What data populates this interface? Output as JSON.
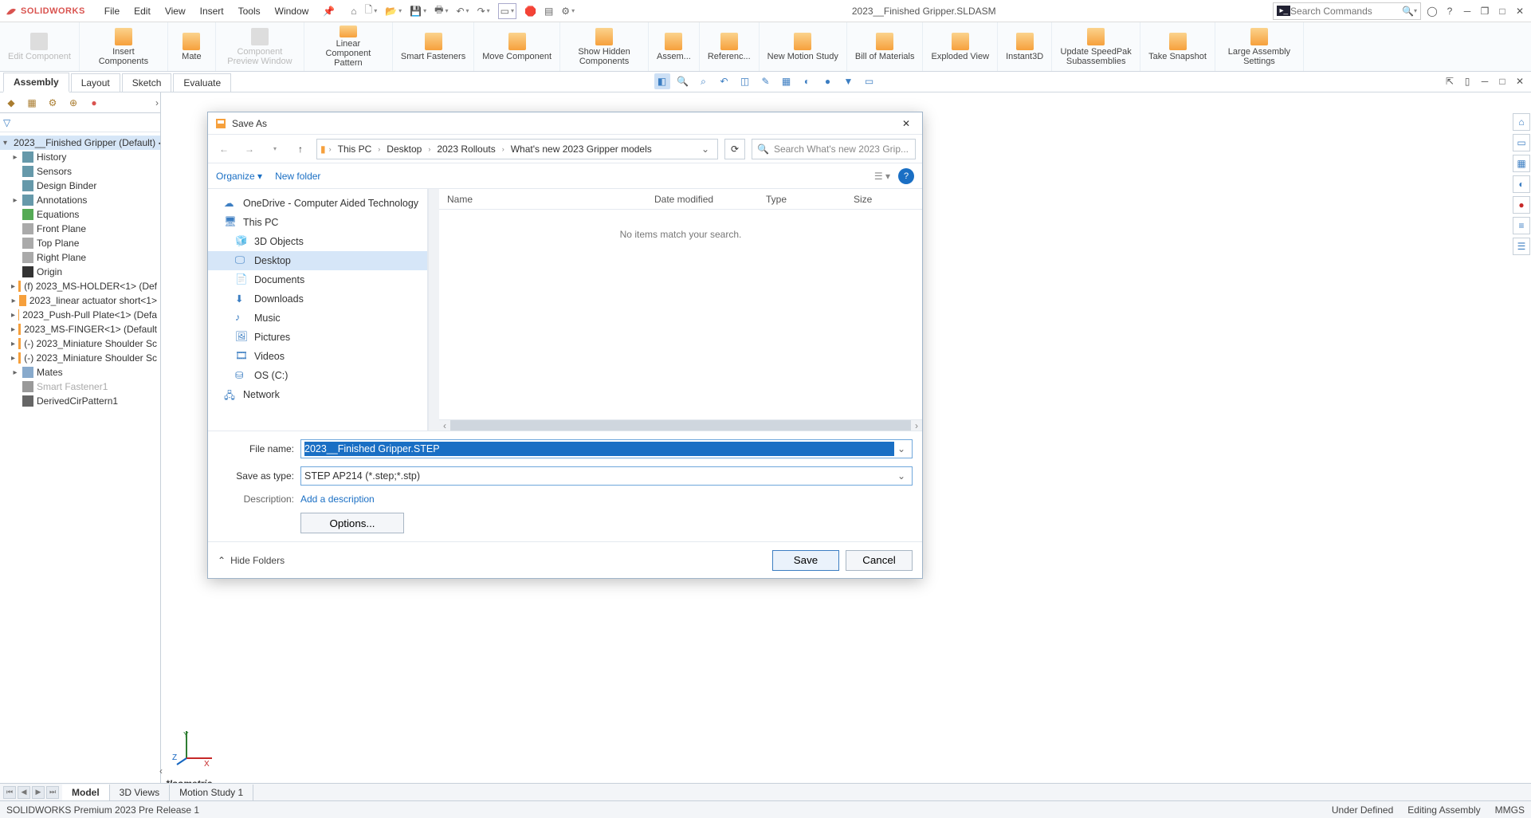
{
  "app": {
    "brand": "SOLIDWORKS",
    "title": "2023__Finished Gripper.SLDASM",
    "search_placeholder": "Search Commands"
  },
  "menu": [
    "File",
    "Edit",
    "View",
    "Insert",
    "Tools",
    "Window"
  ],
  "ribbon": [
    {
      "label": "Edit Component",
      "disabled": true
    },
    {
      "label": "Insert Components"
    },
    {
      "label": "Mate"
    },
    {
      "label": "Component Preview Window",
      "disabled": true
    },
    {
      "label": "Linear Component Pattern"
    },
    {
      "label": "Smart Fasteners"
    },
    {
      "label": "Move Component"
    },
    {
      "label": "Show Hidden Components"
    },
    {
      "label": "Assem..."
    },
    {
      "label": "Referenc..."
    },
    {
      "label": "New Motion Study"
    },
    {
      "label": "Bill of Materials"
    },
    {
      "label": "Exploded View"
    },
    {
      "label": "Instant3D"
    },
    {
      "label": "Update SpeedPak Subassemblies"
    },
    {
      "label": "Take Snapshot"
    },
    {
      "label": "Large Assembly Settings"
    }
  ],
  "tabs": [
    "Assembly",
    "Layout",
    "Sketch",
    "Evaluate"
  ],
  "active_tab": "Assembly",
  "tree": {
    "root": "2023__Finished Gripper (Default) ◂",
    "items": [
      "History",
      "Sensors",
      "Design Binder",
      "Annotations",
      "Equations",
      "Front Plane",
      "Top Plane",
      "Right Plane",
      "Origin",
      "(f) 2023_MS-HOLDER<1> (Def",
      "2023_linear actuator short<1>",
      "2023_Push-Pull Plate<1> (Defa",
      "2023_MS-FINGER<1> (Default",
      "(-) 2023_Miniature Shoulder Sc",
      "(-) 2023_Miniature Shoulder Sc",
      "Mates",
      "Smart Fastener1",
      "DerivedCirPattern1"
    ]
  },
  "bottom_tabs": [
    "Model",
    "3D Views",
    "Motion Study 1"
  ],
  "iso_label": "*Isometric",
  "status": {
    "left": "SOLIDWORKS Premium 2023 Pre Release 1",
    "right": [
      "Under Defined",
      "Editing Assembly",
      "MMGS"
    ]
  },
  "dialog": {
    "title": "Save As",
    "breadcrumb": [
      "This PC",
      "Desktop",
      "2023 Rollouts",
      "What's new 2023 Gripper models"
    ],
    "search_placeholder": "Search What's new 2023 Grip...",
    "organize": "Organize",
    "new_folder": "New folder",
    "nav": [
      {
        "label": "OneDrive - Computer Aided Technology",
        "icon": "cloud"
      },
      {
        "label": "This PC",
        "icon": "pc"
      },
      {
        "label": "3D Objects",
        "icon": "3d",
        "indent": true
      },
      {
        "label": "Desktop",
        "icon": "desktop",
        "indent": true,
        "selected": true
      },
      {
        "label": "Documents",
        "icon": "doc",
        "indent": true
      },
      {
        "label": "Downloads",
        "icon": "dl",
        "indent": true
      },
      {
        "label": "Music",
        "icon": "music",
        "indent": true
      },
      {
        "label": "Pictures",
        "icon": "pic",
        "indent": true
      },
      {
        "label": "Videos",
        "icon": "vid",
        "indent": true
      },
      {
        "label": "OS (C:)",
        "icon": "drive",
        "indent": true
      },
      {
        "label": "Network",
        "icon": "net"
      }
    ],
    "columns": [
      "Name",
      "Date modified",
      "Type",
      "Size"
    ],
    "empty_text": "No items match your search.",
    "file_name_label": "File name:",
    "file_name": "2023__Finished Gripper.STEP",
    "save_type_label": "Save as type:",
    "save_type": "STEP AP214 (*.step;*.stp)",
    "description_label": "Description:",
    "description_link": "Add a description",
    "options": "Options...",
    "hide_folders": "Hide Folders",
    "save": "Save",
    "cancel": "Cancel"
  }
}
